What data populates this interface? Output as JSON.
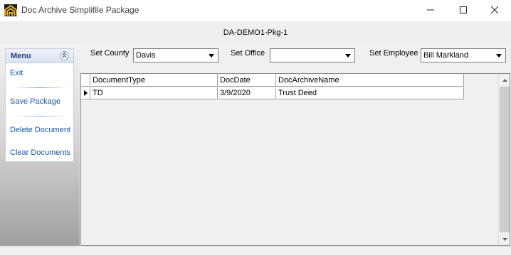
{
  "window": {
    "title": "Doc Archive Simplifile Package",
    "icon": "doc-archive-logo-icon",
    "controls": [
      "minimize-icon",
      "maximize-icon",
      "close-icon"
    ]
  },
  "package": {
    "name": "DA-DEMO1-Pkg-1"
  },
  "menu": {
    "title": "Menu",
    "items": {
      "exit": "Exit",
      "save_package": "Save Package",
      "delete_document": "Delete Document",
      "clear_documents": "Clear Documents"
    }
  },
  "filters": {
    "county": {
      "label": "Set County",
      "value": "Davis"
    },
    "office": {
      "label": "Set Office",
      "value": ""
    },
    "employee": {
      "label": "Set Employee",
      "value": "Bill Markland"
    }
  },
  "grid": {
    "columns": [
      "DocumentType",
      "DocDate",
      "DocArchiveName"
    ],
    "rows": [
      [
        "TD",
        "3/9/2020",
        "Trust Deed"
      ]
    ]
  },
  "colors": {
    "menu_link": "#1a57a3",
    "menu_title": "#1f3d7a",
    "grid_background": "#ababab"
  }
}
